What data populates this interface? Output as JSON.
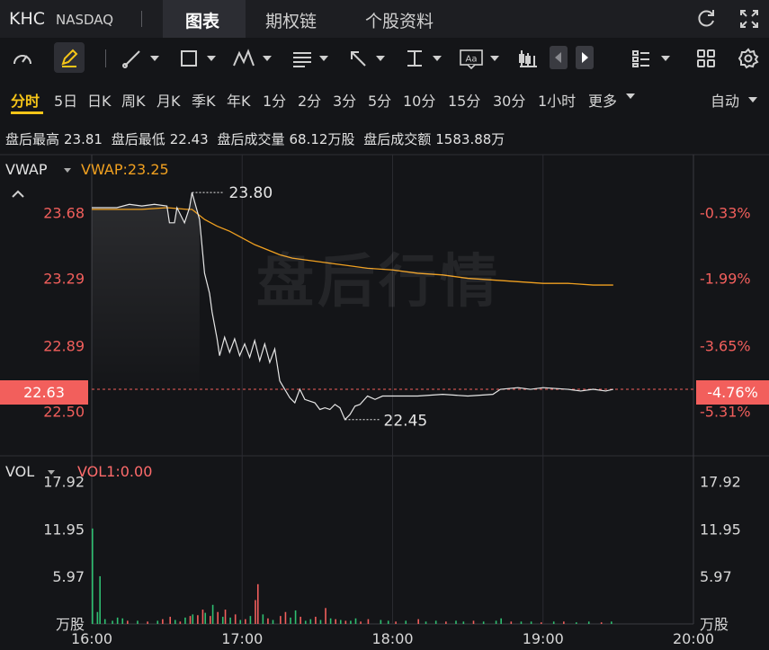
{
  "header": {
    "ticker": "KHC",
    "exchange": "NASDAQ",
    "tabs": [
      {
        "label": "图表",
        "active": true
      },
      {
        "label": "期权链",
        "active": false
      },
      {
        "label": "个股资料",
        "active": false
      }
    ],
    "icons": [
      "refresh-icon",
      "fullscreen-icon"
    ]
  },
  "toolbar": {
    "icons": [
      "indicator-gauge-icon",
      "draw-pen-icon",
      "line-tool-icon",
      "rectangle-tool-icon",
      "pattern-tool-icon",
      "fibonacci-tool-icon",
      "arrow-tool-icon",
      "measure-tool-icon",
      "text-tool-icon",
      "candlestick-icon",
      "prev-arrow-icon",
      "next-arrow-icon",
      "layout-list-icon",
      "grid-layout-icon",
      "settings-icon"
    ],
    "text_tool_label": "Aa"
  },
  "periods": {
    "items": [
      "分时",
      "5日",
      "日K",
      "周K",
      "月K",
      "季K",
      "年K",
      "1分",
      "2分",
      "3分",
      "5分",
      "10分",
      "15分",
      "30分",
      "1小时",
      "更多"
    ],
    "active": "分时",
    "auto_label": "自动"
  },
  "stats": {
    "high_label": "盘后最高",
    "high": "23.81",
    "low_label": "盘后最低",
    "low": "22.43",
    "volume_label": "盘后成交量",
    "volume": "68.12万股",
    "turnover_label": "盘后成交额",
    "turnover": "1583.88万"
  },
  "price_panel": {
    "indicator": "VWAP",
    "indicator_value": "VWAP:23.25",
    "watermark": "盘后行情",
    "current_price": "22.63",
    "current_pct": "-4.76%",
    "high_marker": "23.80",
    "low_marker": "22.45"
  },
  "volume_panel": {
    "indicator": "VOL",
    "indicator_value": "VOL1:0.00",
    "unit": "万股"
  },
  "colors": {
    "background": "#141518",
    "price_line": "#e6e6e6",
    "vwap_line": "#f0a020",
    "down": "#f25f5c",
    "up": "#2fbf71",
    "grid": "#2a2b30",
    "accent": "#f5c518"
  },
  "chart_data": {
    "type": "line",
    "x_ticks": [
      "16:00",
      "17:00",
      "18:00",
      "19:00",
      "20:00"
    ],
    "price_ticks": [
      "23.68",
      "23.29",
      "22.89",
      "22.50"
    ],
    "pct_ticks": [
      "-0.33%",
      "-1.99%",
      "-3.65%",
      "-5.31%"
    ],
    "volume_ticks": [
      "17.92",
      "11.95",
      "5.97"
    ],
    "x_range_minutes": [
      0,
      240
    ],
    "price_range": [
      22.24,
      24.02
    ],
    "volume_range": [
      0,
      20.8
    ],
    "reference_price": 22.63,
    "series": [
      {
        "name": "price",
        "points": [
          [
            0,
            23.71
          ],
          [
            10,
            23.71
          ],
          [
            15,
            23.73
          ],
          [
            20,
            23.72
          ],
          [
            25,
            23.73
          ],
          [
            30,
            23.72
          ],
          [
            31,
            23.62
          ],
          [
            33,
            23.62
          ],
          [
            34,
            23.71
          ],
          [
            37,
            23.62
          ],
          [
            39,
            23.71
          ],
          [
            40,
            23.8
          ],
          [
            43,
            23.64
          ],
          [
            45,
            23.32
          ],
          [
            47,
            23.2
          ],
          [
            48,
            23.09
          ],
          [
            50,
            22.93
          ],
          [
            51,
            22.83
          ],
          [
            53,
            22.94
          ],
          [
            55,
            22.85
          ],
          [
            57,
            22.93
          ],
          [
            59,
            22.83
          ],
          [
            61,
            22.9
          ],
          [
            63,
            22.82
          ],
          [
            65,
            22.92
          ],
          [
            67,
            22.8
          ],
          [
            69,
            22.9
          ],
          [
            71,
            22.79
          ],
          [
            73,
            22.87
          ],
          [
            75,
            22.68
          ],
          [
            77,
            22.63
          ],
          [
            79,
            22.58
          ],
          [
            81,
            22.55
          ],
          [
            83,
            22.63
          ],
          [
            85,
            22.57
          ],
          [
            87,
            22.56
          ],
          [
            89,
            22.55
          ],
          [
            91,
            22.51
          ],
          [
            93,
            22.52
          ],
          [
            95,
            22.51
          ],
          [
            97,
            22.54
          ],
          [
            99,
            22.52
          ],
          [
            101,
            22.45
          ],
          [
            103,
            22.48
          ],
          [
            105,
            22.53
          ],
          [
            107,
            22.54
          ],
          [
            110,
            22.59
          ],
          [
            113,
            22.57
          ],
          [
            116,
            22.59
          ],
          [
            120,
            22.59
          ],
          [
            130,
            22.59
          ],
          [
            140,
            22.6
          ],
          [
            150,
            22.59
          ],
          [
            160,
            22.6
          ],
          [
            163,
            22.63
          ],
          [
            170,
            22.64
          ],
          [
            175,
            22.63
          ],
          [
            180,
            22.64
          ],
          [
            190,
            22.63
          ],
          [
            195,
            22.62
          ],
          [
            200,
            22.63
          ],
          [
            205,
            22.62
          ],
          [
            208,
            22.63
          ]
        ]
      },
      {
        "name": "VWAP",
        "points": [
          [
            0,
            23.7
          ],
          [
            20,
            23.7
          ],
          [
            30,
            23.71
          ],
          [
            38,
            23.7
          ],
          [
            40,
            23.7
          ],
          [
            45,
            23.64
          ],
          [
            50,
            23.6
          ],
          [
            55,
            23.57
          ],
          [
            60,
            23.53
          ],
          [
            65,
            23.49
          ],
          [
            70,
            23.46
          ],
          [
            75,
            23.43
          ],
          [
            80,
            23.41
          ],
          [
            90,
            23.39
          ],
          [
            100,
            23.37
          ],
          [
            110,
            23.35
          ],
          [
            120,
            23.34
          ],
          [
            130,
            23.32
          ],
          [
            140,
            23.31
          ],
          [
            150,
            23.29
          ],
          [
            160,
            23.28
          ],
          [
            170,
            23.27
          ],
          [
            180,
            23.26
          ],
          [
            190,
            23.26
          ],
          [
            200,
            23.25
          ],
          [
            208,
            23.25
          ]
        ]
      }
    ],
    "volume": [
      {
        "t": 0,
        "v": 12.0,
        "c": "up"
      },
      {
        "t": 2,
        "v": 1.5,
        "c": "up"
      },
      {
        "t": 3,
        "v": 6.0,
        "c": "up"
      },
      {
        "t": 5,
        "v": 0.6,
        "c": "up"
      },
      {
        "t": 8,
        "v": 0.4,
        "c": "up"
      },
      {
        "t": 10,
        "v": 0.8,
        "c": "up"
      },
      {
        "t": 12,
        "v": 0.7,
        "c": "up"
      },
      {
        "t": 14,
        "v": 0.4,
        "c": "down"
      },
      {
        "t": 18,
        "v": 0.4,
        "c": "up"
      },
      {
        "t": 22,
        "v": 0.3,
        "c": "down"
      },
      {
        "t": 26,
        "v": 0.4,
        "c": "up"
      },
      {
        "t": 28,
        "v": 0.6,
        "c": "down"
      },
      {
        "t": 31,
        "v": 0.9,
        "c": "down"
      },
      {
        "t": 33,
        "v": 0.5,
        "c": "up"
      },
      {
        "t": 35,
        "v": 0.3,
        "c": "down"
      },
      {
        "t": 37,
        "v": 0.8,
        "c": "up"
      },
      {
        "t": 39,
        "v": 1.0,
        "c": "down"
      },
      {
        "t": 40,
        "v": 1.2,
        "c": "up"
      },
      {
        "t": 42,
        "v": 1.1,
        "c": "down"
      },
      {
        "t": 44,
        "v": 1.8,
        "c": "down"
      },
      {
        "t": 45,
        "v": 1.4,
        "c": "up"
      },
      {
        "t": 47,
        "v": 1.0,
        "c": "down"
      },
      {
        "t": 48,
        "v": 2.4,
        "c": "up"
      },
      {
        "t": 50,
        "v": 1.5,
        "c": "down"
      },
      {
        "t": 52,
        "v": 0.9,
        "c": "up"
      },
      {
        "t": 53,
        "v": 1.8,
        "c": "down"
      },
      {
        "t": 55,
        "v": 0.8,
        "c": "up"
      },
      {
        "t": 57,
        "v": 1.2,
        "c": "down"
      },
      {
        "t": 59,
        "v": 0.5,
        "c": "up"
      },
      {
        "t": 61,
        "v": 0.6,
        "c": "down"
      },
      {
        "t": 63,
        "v": 1.0,
        "c": "up"
      },
      {
        "t": 65,
        "v": 3.0,
        "c": "down"
      },
      {
        "t": 66,
        "v": 5.0,
        "c": "down"
      },
      {
        "t": 68,
        "v": 1.2,
        "c": "up"
      },
      {
        "t": 70,
        "v": 0.7,
        "c": "down"
      },
      {
        "t": 72,
        "v": 0.5,
        "c": "up"
      },
      {
        "t": 75,
        "v": 1.0,
        "c": "down"
      },
      {
        "t": 77,
        "v": 1.5,
        "c": "down"
      },
      {
        "t": 79,
        "v": 0.8,
        "c": "up"
      },
      {
        "t": 81,
        "v": 1.7,
        "c": "up"
      },
      {
        "t": 83,
        "v": 0.9,
        "c": "down"
      },
      {
        "t": 85,
        "v": 0.4,
        "c": "up"
      },
      {
        "t": 87,
        "v": 0.6,
        "c": "up"
      },
      {
        "t": 89,
        "v": 0.9,
        "c": "down"
      },
      {
        "t": 91,
        "v": 0.5,
        "c": "up"
      },
      {
        "t": 93,
        "v": 2.0,
        "c": "down"
      },
      {
        "t": 95,
        "v": 0.7,
        "c": "up"
      },
      {
        "t": 97,
        "v": 0.6,
        "c": "down"
      },
      {
        "t": 99,
        "v": 0.5,
        "c": "up"
      },
      {
        "t": 101,
        "v": 0.4,
        "c": "down"
      },
      {
        "t": 103,
        "v": 0.4,
        "c": "up"
      },
      {
        "t": 105,
        "v": 0.7,
        "c": "up"
      },
      {
        "t": 107,
        "v": 0.3,
        "c": "down"
      },
      {
        "t": 110,
        "v": 0.6,
        "c": "down"
      },
      {
        "t": 115,
        "v": 0.5,
        "c": "up"
      },
      {
        "t": 118,
        "v": 0.4,
        "c": "up"
      },
      {
        "t": 121,
        "v": 0.3,
        "c": "down"
      },
      {
        "t": 125,
        "v": 0.4,
        "c": "up"
      },
      {
        "t": 130,
        "v": 0.6,
        "c": "down"
      },
      {
        "t": 133,
        "v": 0.3,
        "c": "up"
      },
      {
        "t": 137,
        "v": 0.4,
        "c": "up"
      },
      {
        "t": 141,
        "v": 0.3,
        "c": "down"
      },
      {
        "t": 145,
        "v": 0.4,
        "c": "up"
      },
      {
        "t": 148,
        "v": 0.3,
        "c": "up"
      },
      {
        "t": 152,
        "v": 0.4,
        "c": "down"
      },
      {
        "t": 156,
        "v": 0.3,
        "c": "up"
      },
      {
        "t": 161,
        "v": 0.4,
        "c": "up"
      },
      {
        "t": 163,
        "v": 0.7,
        "c": "up"
      },
      {
        "t": 167,
        "v": 0.3,
        "c": "down"
      },
      {
        "t": 171,
        "v": 0.3,
        "c": "up"
      },
      {
        "t": 175,
        "v": 0.3,
        "c": "up"
      },
      {
        "t": 179,
        "v": 0.2,
        "c": "down"
      },
      {
        "t": 184,
        "v": 0.3,
        "c": "up"
      },
      {
        "t": 188,
        "v": 0.3,
        "c": "down"
      },
      {
        "t": 193,
        "v": 0.2,
        "c": "up"
      },
      {
        "t": 198,
        "v": 0.3,
        "c": "up"
      },
      {
        "t": 203,
        "v": 0.2,
        "c": "down"
      },
      {
        "t": 207,
        "v": 0.3,
        "c": "up"
      }
    ]
  }
}
